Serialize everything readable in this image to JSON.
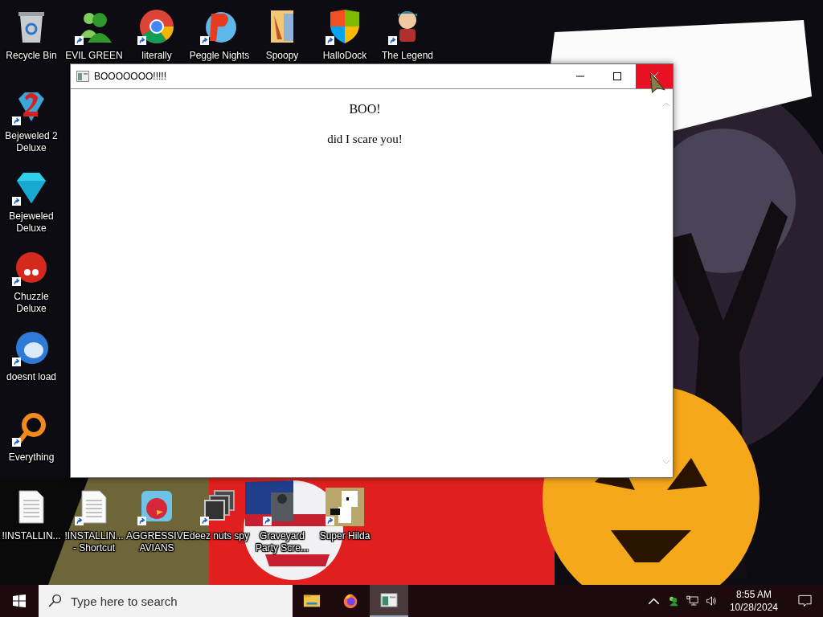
{
  "desktop_icons": [
    {
      "label": "Recycle Bin",
      "shortcut": false
    },
    {
      "label": "EVIL GREEN",
      "shortcut": true
    },
    {
      "label": "literally",
      "shortcut": true
    },
    {
      "label": "Peggle Nights",
      "shortcut": true
    },
    {
      "label": "Spoopy",
      "shortcut": false
    },
    {
      "label": "HalloDock",
      "shortcut": true
    },
    {
      "label": "The Legend",
      "shortcut": true
    },
    {
      "label": "Bejeweled 2 Deluxe",
      "shortcut": true
    },
    {
      "label": "Bejeweled Deluxe",
      "shortcut": true
    },
    {
      "label": "Chuzzle Deluxe",
      "shortcut": true
    },
    {
      "label": "doesnt load",
      "shortcut": true
    },
    {
      "label": "Everything",
      "shortcut": true
    },
    {
      "label": "!INSTALLIN...",
      "shortcut": false
    },
    {
      "label": "!INSTALLIN... - Shortcut",
      "shortcut": true
    },
    {
      "label": "AGGRESSIVE AVIANS",
      "shortcut": true
    },
    {
      "label": "deez nuts spy",
      "shortcut": true
    },
    {
      "label": "Graveyard Party Scre...",
      "shortcut": true
    },
    {
      "label": "Super Hilda",
      "shortcut": true
    }
  ],
  "window": {
    "title": "BOOOOOOO!!!!!",
    "close_hovered": true,
    "heading": "BOO!",
    "message": "did I scare you!"
  },
  "taskbar": {
    "search": {
      "placeholder": "Type here to search"
    },
    "apps": [
      {
        "selected": false
      },
      {
        "selected": false
      },
      {
        "selected": true
      }
    ],
    "tray": {
      "time": "8:55 AM",
      "date": "10/28/2024"
    }
  }
}
